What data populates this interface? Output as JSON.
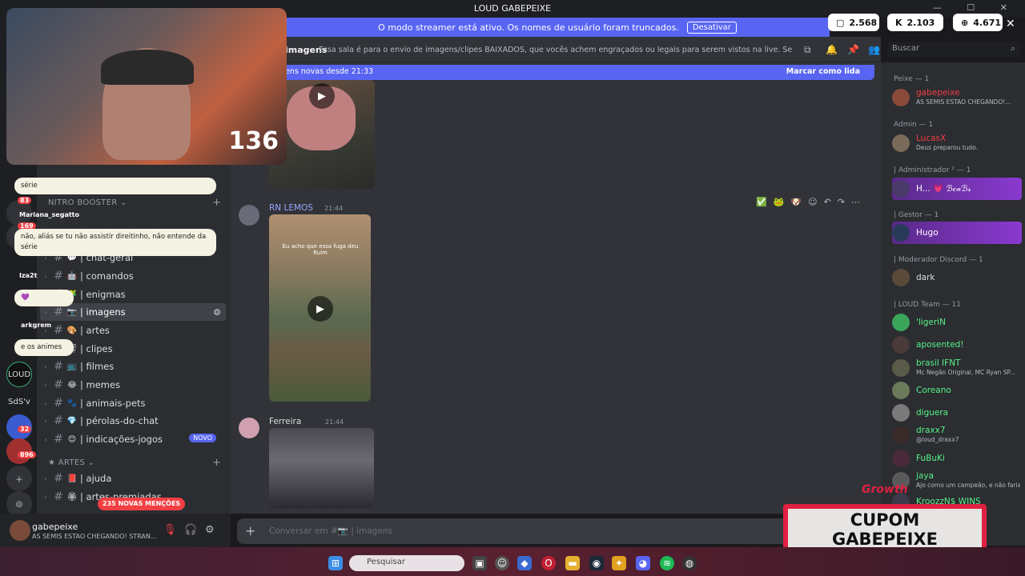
{
  "window": {
    "title": "LOUD GABEPEIXE"
  },
  "banner": {
    "text": "O modo streamer está ativo. Os nomes de usuário foram truncados.",
    "button": "Desativar"
  },
  "counters": [
    {
      "icon": "chat-icon",
      "value": "2.568"
    },
    {
      "icon": "kick-icon",
      "value": "2.103"
    },
    {
      "icon": "globe-icon",
      "value": "4.671"
    }
  ],
  "header": {
    "channel": "imagens",
    "topic": "Essa sala é para o envio de imagens/clipes BAIXADOS, que vocês achem engraçados ou legais para serem vistos na live. Serão apagados prints de o...",
    "search_placeholder": "Buscar"
  },
  "newbar": {
    "text": "ens novas desde 21:33",
    "mark": "Marcar como lida"
  },
  "sidebar": {
    "cat1": "NITRO BOOSTER",
    "channels": [
      {
        "emoji": "💬",
        "name": "| chat-geral"
      },
      {
        "emoji": "🤖",
        "name": "| comandos"
      },
      {
        "emoji": "🧩",
        "name": "| enigmas"
      },
      {
        "emoji": "📷",
        "name": "| imagens"
      },
      {
        "emoji": "🎨",
        "name": "| artes"
      },
      {
        "emoji": "🎬",
        "name": "| clipes"
      },
      {
        "emoji": "📺",
        "name": "| filmes"
      },
      {
        "emoji": "😂",
        "name": "| memes"
      },
      {
        "emoji": "🐾",
        "name": "| animais-pets"
      },
      {
        "emoji": "💎",
        "name": "| pérolas-do-chat"
      },
      {
        "emoji": "😊",
        "name": "| indicações-jogos"
      }
    ],
    "novo": "NOVO",
    "cat2": "ARTES",
    "channels2": [
      {
        "emoji": "📕",
        "name": "| ajuda"
      },
      {
        "emoji": "🏵",
        "name": "| artes-premiadas"
      }
    ],
    "mentions": "235 NOVAS MENÇÕES"
  },
  "guild_badges": [
    "83",
    "169",
    "32",
    "896"
  ],
  "guild_labels": [
    "SdS'v"
  ],
  "user": {
    "name": "gabepeixe",
    "status": "AS SEMIS ESTAO CHEGANDO! STRAN..."
  },
  "messages": [
    {
      "author": "RN LEMOS",
      "time": "21:44",
      "video_caption": "Eu acho que essa fuga deu Ruim"
    },
    {
      "author": "Ferreira",
      "time": "21:44"
    }
  ],
  "composer": {
    "placeholder": "Conversar em #📷 | imagens"
  },
  "members": {
    "groups": [
      {
        "role": "Peixe — 1",
        "items": [
          {
            "name": "gabepeixe",
            "status": "AS SEMIS ESTAO CHEGANDO!...",
            "color": "#f23f43"
          }
        ]
      },
      {
        "role": "Admin — 1",
        "items": [
          {
            "name": "LucasX",
            "status": "Deus preparou tudo.",
            "color": "#f23f43"
          }
        ]
      },
      {
        "role": "| Administrador ² — 1",
        "items": [
          {
            "name": "H... 💗 ℬ𝒸𝓃ℬ𝓈",
            "status": "",
            "color": "#ffffff"
          }
        ]
      },
      {
        "role": "| Gestor — 1",
        "items": [
          {
            "name": "Hugo",
            "status": "",
            "color": "#ffffff"
          }
        ]
      },
      {
        "role": "| Moderador Discord — 1",
        "items": [
          {
            "name": "dark",
            "status": "",
            "color": "#dbdee1"
          }
        ]
      },
      {
        "role": "| LOUD Team — 11",
        "items": [
          {
            "name": "'ligeriN",
            "status": "",
            "color": "#57f287"
          },
          {
            "name": "aposented!",
            "status": "",
            "color": "#57f287"
          },
          {
            "name": "brasil  IFNT",
            "status": "Mc Negão Original, MC Ryan SP...",
            "color": "#57f287"
          },
          {
            "name": "Coreano",
            "status": "",
            "color": "#57f287"
          },
          {
            "name": "diguera",
            "status": "",
            "color": "#57f287"
          },
          {
            "name": "draxx7",
            "status": "@loud_draxx7",
            "color": "#57f287"
          },
          {
            "name": "FuBuKi",
            "status": "",
            "color": "#57f287"
          },
          {
            "name": "jaya",
            "status": "Ajo como um campeão, e não faria...",
            "color": "#57f287"
          },
          {
            "name": "KroozzN$  WINS",
            "status": "",
            "color": "#57f287"
          }
        ]
      }
    ]
  },
  "overlay": {
    "webcam_count": "136",
    "chat": [
      {
        "name": "",
        "text": "série"
      },
      {
        "name": "Mariana_segatto",
        "text": "não, aliás se tu não assistir direitinho, não entende da série"
      },
      {
        "name": "Iza2t",
        "text": "💜"
      },
      {
        "name": "arkgrem",
        "text": "e os animes"
      }
    ],
    "growth": "Growth",
    "cupom": [
      "CUPOM",
      "GABEPEIXE"
    ]
  },
  "taskbar": {
    "search": "Pesquisar"
  }
}
